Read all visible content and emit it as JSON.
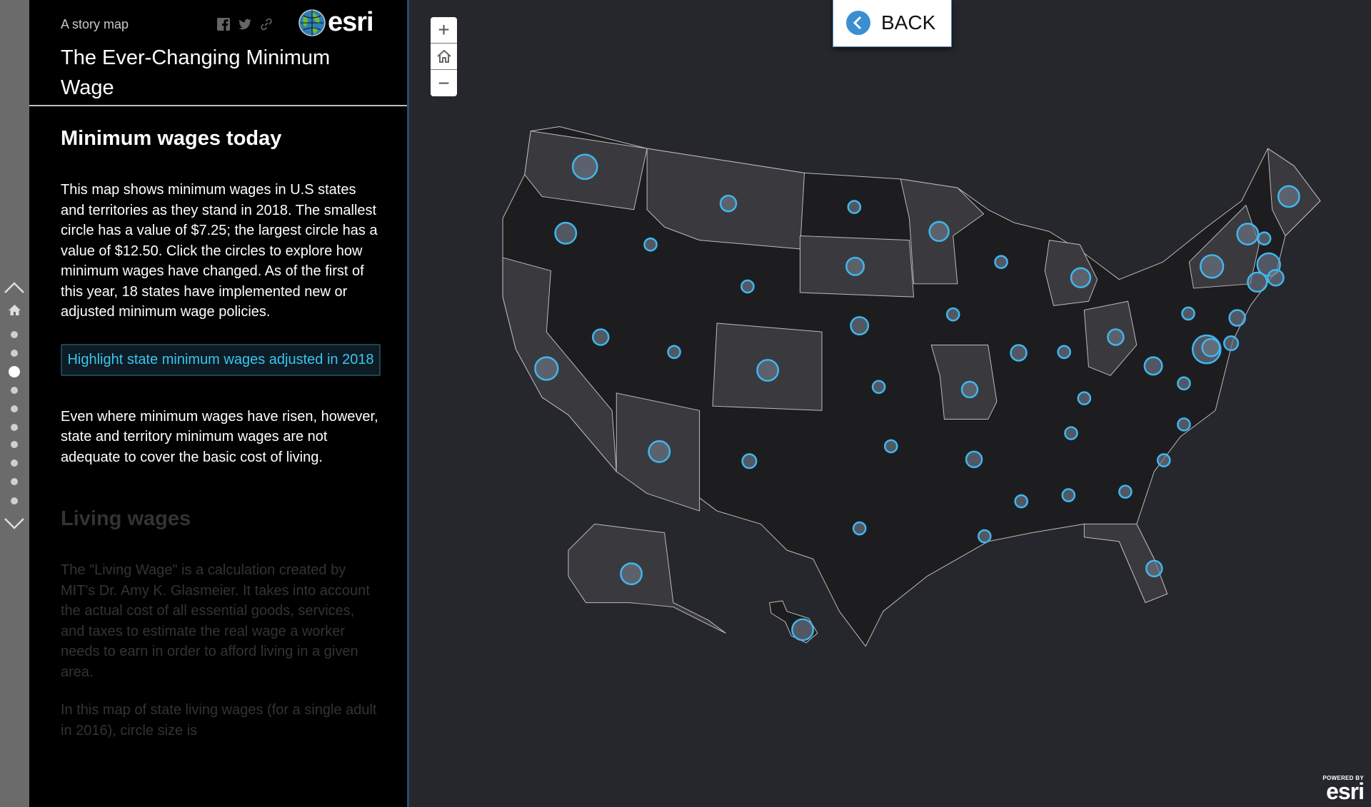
{
  "header": {
    "kicker": "A story map",
    "title": "The Ever-Changing Minimum Wage",
    "logo_text": "esri",
    "share_icons": [
      "facebook-icon",
      "twitter-icon",
      "link-icon"
    ]
  },
  "section1": {
    "heading": "Minimum wages today",
    "paragraph1": "This map shows minimum wages in U.S states and territories as they stand in 2018. The smallest circle has a value of $7.25; the largest circle has a value of $12.50. Click the circles to explore how minimum wages have changed. As of the first of this year, 18 states have implemented new or adjusted minimum wage policies.",
    "button": "Highlight state minimum wages adjusted in 2018",
    "paragraph2": "Even where minimum wages have risen, however, state and territory minimum wages are not adequate to cover the basic cost of living."
  },
  "section2": {
    "heading": "Living wages",
    "paragraph1": "The \"Living Wage\" is a calculation created by MIT's Dr. Amy K. Glasmeier. It takes into account the actual cost of all essential goods, services, and taxes to estimate the real wage a worker needs to earn in order to afford living in a given area.",
    "paragraph2": "In this map of state living wages (for a single adult in 2016), circle size is"
  },
  "nav": {
    "sections": 12,
    "active_index": 2
  },
  "map": {
    "back_label": "BACK",
    "zoom_in": "+",
    "zoom_out": "−",
    "powered_by": "POWERED BY",
    "powered_logo": "esri",
    "min_value": "$7.25",
    "max_value": "$12.50"
  },
  "colors": {
    "accent": "#3cc3ef",
    "circle_stroke": "#3fb8f0",
    "map_bg": "#26272d",
    "state_dark": "#1d1d20",
    "state_light": "#3a3a3e",
    "back_icon": "#3a8fd0"
  }
}
